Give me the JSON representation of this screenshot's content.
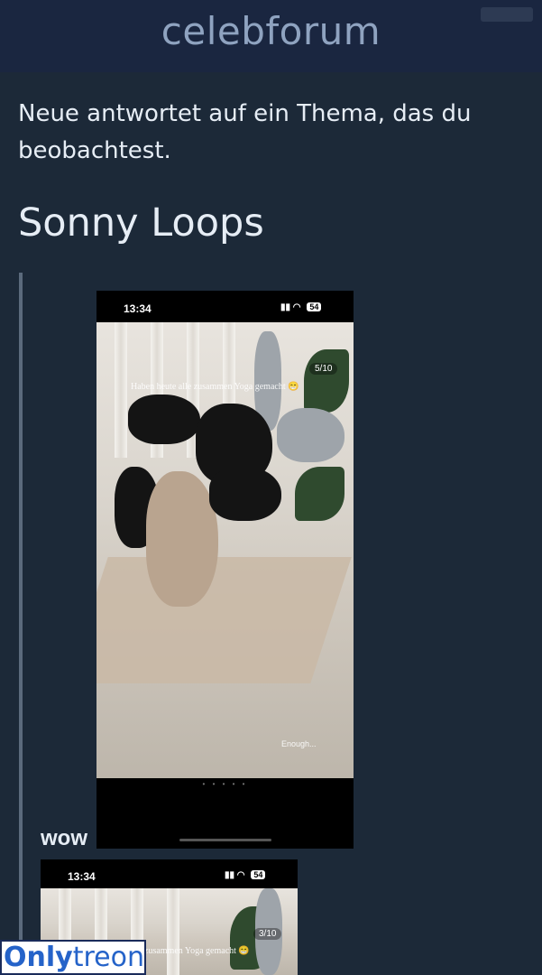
{
  "header": {
    "brand": "celebforum"
  },
  "notification": {
    "text": "Neue antwortet auf ein Thema, das du beobachtest."
  },
  "thread": {
    "title": "Sonny Loops"
  },
  "post": {
    "embed1": {
      "status_time": "13:34",
      "battery": "54",
      "story_counter": "5/10",
      "overlay_text": "Haben heute alle zusammen Yoga gemacht 😁",
      "caption": "Enough..."
    },
    "text": "wow",
    "embed2": {
      "status_time": "13:34",
      "battery": "54",
      "story_counter": "3/10",
      "overlay_text": "zusammen Yoga gemacht 😁"
    }
  },
  "watermark": {
    "part1": "Only",
    "part2": "treon"
  }
}
